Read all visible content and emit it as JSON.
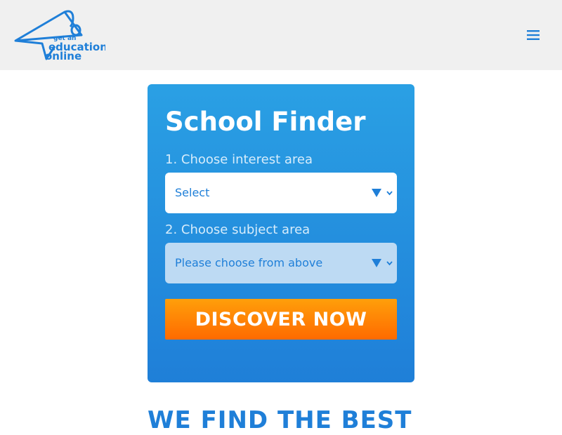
{
  "header": {
    "logo": {
      "line1": "get an",
      "line2": "education",
      "line3": "online"
    },
    "menu_icon": "hamburger-menu-icon"
  },
  "finder": {
    "title": "School Finder",
    "step1_label": "1. Choose interest area",
    "step1_value": "Select",
    "step2_label": "2. Choose subject area",
    "step2_value": "Please choose from above",
    "button_label": "DISCOVER NOW"
  },
  "tagline": "WE FIND THE BEST",
  "colors": {
    "brand_blue": "#1f7fd8",
    "card_top": "#2aa0e4",
    "button_orange": "#ff7a00",
    "header_bg": "#f0f0f0"
  }
}
